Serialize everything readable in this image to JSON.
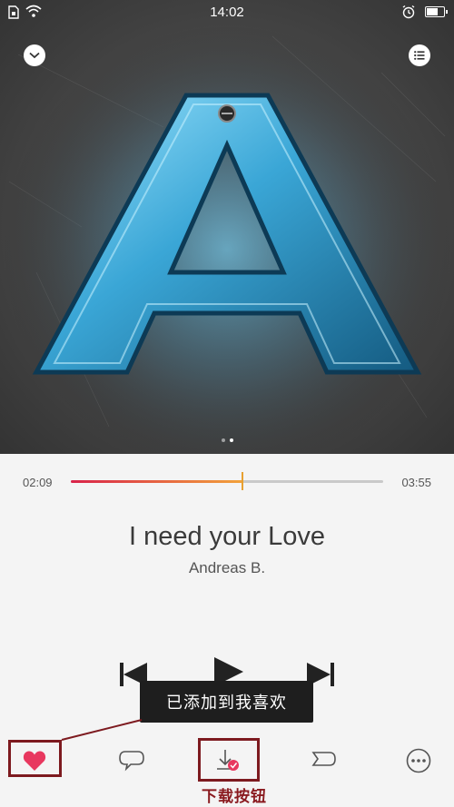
{
  "status_bar": {
    "time": "14:02"
  },
  "album": {
    "letter_art": "A",
    "page_count": 2,
    "active_page": 1
  },
  "player": {
    "current_time": "02:09",
    "total_time": "03:55",
    "progress": 0.55,
    "title": "I need your Love",
    "artist": "Andreas B."
  },
  "toast": {
    "text": "已添加到我喜欢"
  },
  "annotation": {
    "download_label": "下载按钮"
  },
  "icons": {
    "collapse": "chevron-down-icon",
    "playlist": "list-icon",
    "prev": "skip-previous-icon",
    "play": "play-icon",
    "next": "skip-next-icon",
    "like": "heart-icon",
    "comment": "comment-icon",
    "download": "download-icon",
    "share": "share-icon",
    "more": "more-icon"
  },
  "colors": {
    "accent": "#e8385f",
    "progress_start": "#d9234a",
    "progress_end": "#f2a23a",
    "annotation": "#8a1a1f"
  }
}
